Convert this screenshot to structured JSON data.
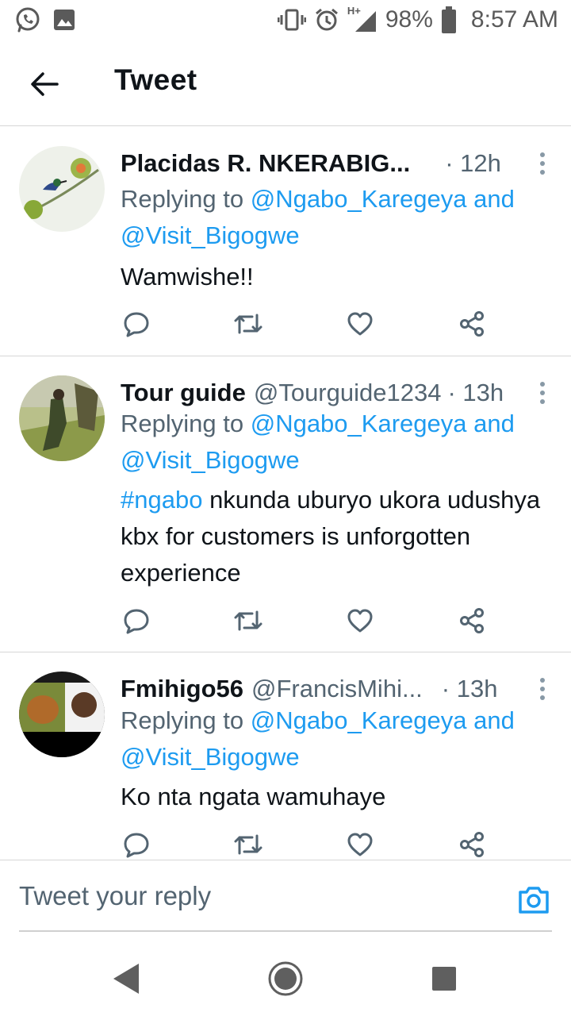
{
  "status_bar": {
    "battery": "98%",
    "time": "8:57 AM",
    "network": "H+"
  },
  "header": {
    "title": "Tweet"
  },
  "tweets": [
    {
      "name": "Placidas R. NKERABIG...",
      "handle": "",
      "time": "· 12h",
      "reply_prefix": "Replying to ",
      "mention_1": "@Ngabo_Karegeya",
      "and": " and",
      "mention_2": "@Visit_Bigogwe",
      "hashtag": "",
      "text": "Wamwishe!!"
    },
    {
      "name": "Tour guide",
      "handle": "@Tourguide1234",
      "time": "· 13h",
      "reply_prefix": "Replying to ",
      "mention_1": "@Ngabo_Karegeya",
      "and": " and",
      "mention_2": "@Visit_Bigogwe",
      "hashtag": "#ngabo",
      "text": " nkunda uburyo ukora udushya kbx for customers is unforgotten experience"
    },
    {
      "name": "Fmihigo56",
      "handle": "@FrancisMihi...",
      "time": "· 13h",
      "reply_prefix": "Replying to ",
      "mention_1": "@Ngabo_Karegeya",
      "and": " and",
      "mention_2": "@Visit_Bigogwe",
      "hashtag": "",
      "text": "Ko nta ngata wamuhaye"
    }
  ],
  "reply_bar": {
    "placeholder": "Tweet your reply"
  },
  "colors": {
    "accent": "#1d9bf0",
    "secondary_text": "#536471",
    "primary_text": "#0f1419",
    "divider": "#d6d6d6"
  },
  "icons": {
    "status_left": [
      "whatsapp-icon",
      "gallery-icon"
    ],
    "status_right": [
      "vibrate-icon",
      "alarm-icon",
      "signal-icon",
      "battery-icon"
    ],
    "tweet_actions": [
      "reply-icon",
      "retweet-icon",
      "like-icon",
      "share-icon"
    ],
    "reply_bar": [
      "camera-icon"
    ],
    "nav": [
      "nav-back-icon",
      "nav-home-icon",
      "nav-recents-icon"
    ]
  }
}
